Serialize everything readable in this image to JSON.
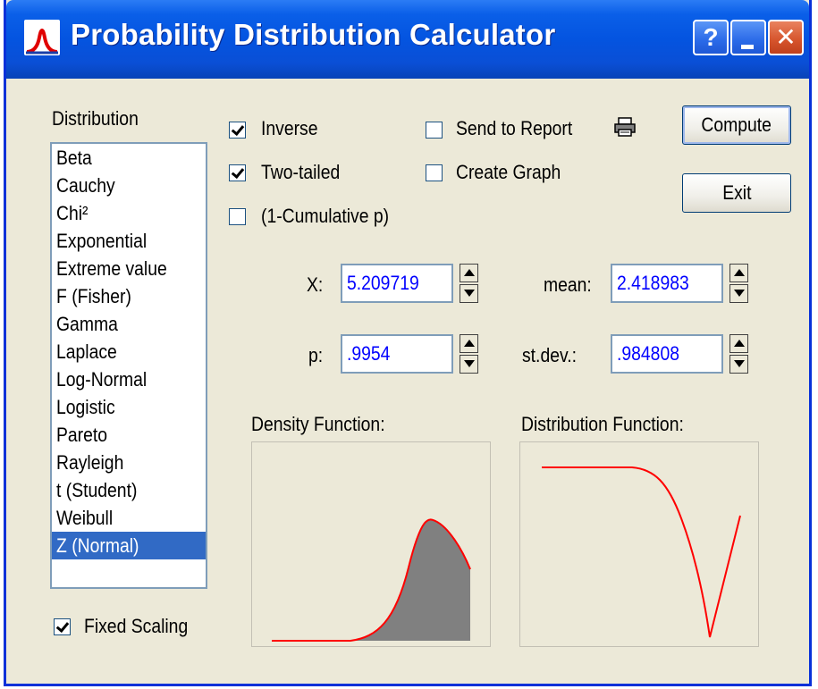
{
  "window": {
    "title": "Probability Distribution Calculator",
    "help_label": "?",
    "close_label": "✕"
  },
  "distribution": {
    "label": "Distribution",
    "items": [
      "Beta",
      "Cauchy",
      "Chi²",
      "Exponential",
      "Extreme value",
      "F (Fisher)",
      "Gamma",
      "Laplace",
      "Log-Normal",
      "Logistic",
      "Pareto",
      "Rayleigh",
      "t (Student)",
      "Weibull",
      "Z (Normal)"
    ],
    "selected": "Z (Normal)"
  },
  "options": {
    "inverse": {
      "label": "Inverse",
      "checked": true
    },
    "two_tailed": {
      "label": "Two-tailed",
      "checked": true
    },
    "one_minus_cum": {
      "label": "(1-Cumulative p)",
      "checked": false
    },
    "send_to_report": {
      "label": "Send to Report",
      "checked": false
    },
    "create_graph": {
      "label": "Create Graph",
      "checked": false
    },
    "fixed_scaling": {
      "label": "Fixed Scaling",
      "checked": true
    }
  },
  "buttons": {
    "compute": "Compute",
    "exit": "Exit"
  },
  "fields": {
    "x": {
      "label": "X:",
      "value": "5.209719"
    },
    "p": {
      "label": "p:",
      "value": ".9954"
    },
    "mean": {
      "label": "mean:",
      "value": "2.418983"
    },
    "stdev": {
      "label": "st.dev.:",
      "value": ".984808"
    }
  },
  "plots": {
    "density_label": "Density Function:",
    "distribution_label": "Distribution Function:"
  },
  "colors": {
    "titlebar": "#0454e0",
    "field_text": "#0000ff",
    "selection": "#316ac5",
    "curve": "#ff0000",
    "shade": "#808080"
  },
  "icons": {
    "app": "distribution-curve-icon",
    "printer": "printer-icon",
    "help": "help-icon",
    "minimize": "minimize-icon",
    "close": "close-icon"
  }
}
